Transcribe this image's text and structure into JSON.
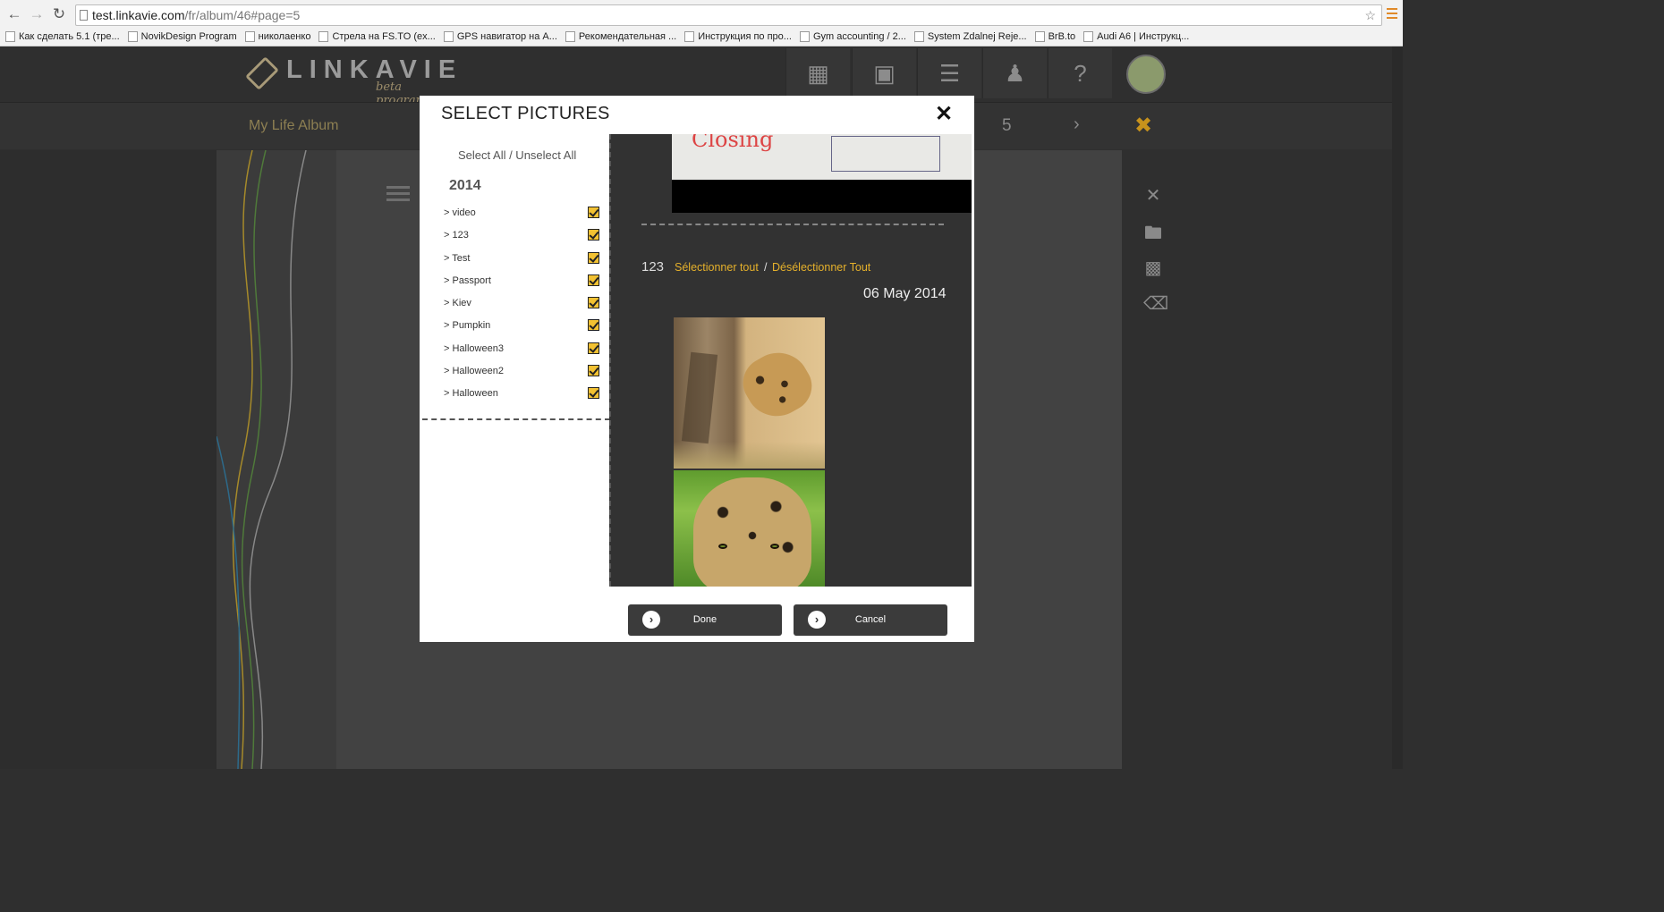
{
  "browser": {
    "url_host": "test.linkavie.com",
    "url_path": "/fr/album/46#page=5",
    "bookmarks": [
      {
        "label": "Как сделать 5.1 (тре...",
        "icon": "favicon-icon"
      },
      {
        "label": "NovikDesign Program",
        "icon": "page-icon"
      },
      {
        "label": "николаенко",
        "icon": "page-icon"
      },
      {
        "label": "Стрела на FS.TO (ex...",
        "icon": "arrow-up-icon"
      },
      {
        "label": "GPS навигатор на A...",
        "icon": "favicon-icon"
      },
      {
        "label": "Рекомендательная ...",
        "icon": "arrow-up-icon"
      },
      {
        "label": "Инструкция по про...",
        "icon": "favicon-icon"
      },
      {
        "label": "Gym accounting / 2...",
        "icon": "sheet-icon"
      },
      {
        "label": "System Zdalnej Reje...",
        "icon": "flag-icon"
      },
      {
        "label": "BrB.to",
        "icon": "arrow-up-icon"
      },
      {
        "label": "Audi A6 | Инструкц...",
        "icon": "favicon-icon"
      }
    ]
  },
  "app": {
    "logo_text": "LINKAVIE",
    "logo_sub": "beta program",
    "album_title": "My Life Album",
    "page_number": "5",
    "help_label": "?"
  },
  "modal": {
    "title": "SELECT PICTURES",
    "select_all": "Select All / Unselect All",
    "year": "2014",
    "folders": [
      {
        "label": "> video",
        "checked": true
      },
      {
        "label": "> 123",
        "checked": true
      },
      {
        "label": "> Test",
        "checked": true
      },
      {
        "label": "> Passport",
        "checked": true
      },
      {
        "label": "> Kiev",
        "checked": true
      },
      {
        "label": "> Pumpkin",
        "checked": true
      },
      {
        "label": "> Halloween3",
        "checked": true
      },
      {
        "label": "> Halloween2",
        "checked": true
      },
      {
        "label": "> Halloween",
        "checked": true
      }
    ],
    "preview": {
      "whiteboard_text": "Closing",
      "group_name": "123",
      "select_all": "Sélectionner tout",
      "separator": "/",
      "unselect_all": "Désélectionner Tout",
      "date": "06 May 2014"
    },
    "done_label": "Done",
    "cancel_label": "Cancel"
  },
  "colors": {
    "accent": "#e6b12b",
    "checkbox": "#f2c132",
    "modal_bg": "#ffffff",
    "preview_bg": "#323232"
  }
}
